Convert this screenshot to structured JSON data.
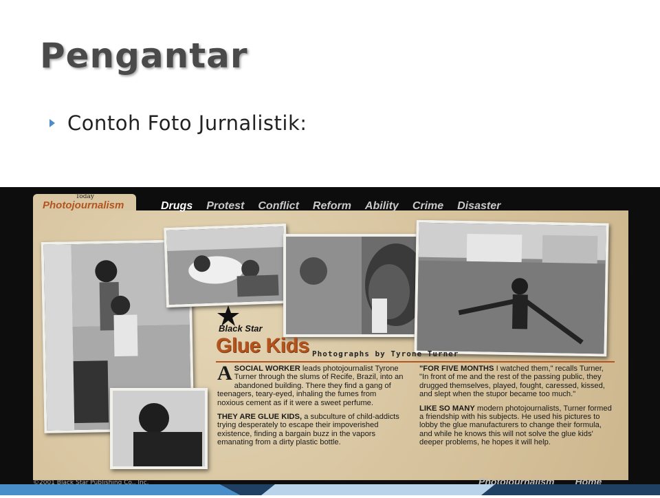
{
  "slide": {
    "title": "Pengantar",
    "bullet": "Contoh Foto Jurnalistik:"
  },
  "website": {
    "header": {
      "today": "Today",
      "logo": "Photojournalism"
    },
    "nav": [
      "Drugs",
      "Protest",
      "Conflict",
      "Reform",
      "Ability",
      "Crime",
      "Disaster"
    ],
    "story": {
      "brand": "Black Star",
      "title": "Glue Kids",
      "byline": "Photographs by Tyrone Turner",
      "col1_p1_lead": "SOCIAL WORKER",
      "col1_p1_dropcap": "A",
      "col1_p1_text": " leads photojournalist Tyrone Turner through the slums of Recife, Brazil, into an abandoned building. There they find a gang of teenagers, teary-eyed, inhaling the fumes from noxious cement as if it were a sweet perfume.",
      "col1_p2_lead": "THEY ARE GLUE KIDS,",
      "col1_p2_text": " a subculture of child-addicts trying desperately to escape their impoverished existence, finding a bargain buzz in the vapors emanating from a dirty plastic bottle.",
      "col2_p1_lead": "\"FOR FIVE MONTHS",
      "col2_p1_text": " I watched them,\" recalls Turner, \"In front of me and the rest of the passing public, they drugged themselves, played, fought, caressed, kissed, and slept when the stupor became too much.\"",
      "col2_p2_lead": "LIKE SO MANY",
      "col2_p2_text": " modern photojournalists, Turner formed a friendship with his subjects. He used his pictures to lobby the glue manufacturers to change their formula, and while he knows this will not solve the glue kids' deeper problems, he hopes it will help."
    },
    "footer": {
      "copyright": "©2001 Black Star Publishing Co., Inc.",
      "links": [
        "Photojournalism",
        "Home"
      ]
    }
  },
  "colors": {
    "title": "#4a4a4a",
    "bullet_icon": "#4a8ec9",
    "accent": "#b3541e",
    "paper": "#d9c7a3",
    "frame": "#0d0d0d"
  }
}
